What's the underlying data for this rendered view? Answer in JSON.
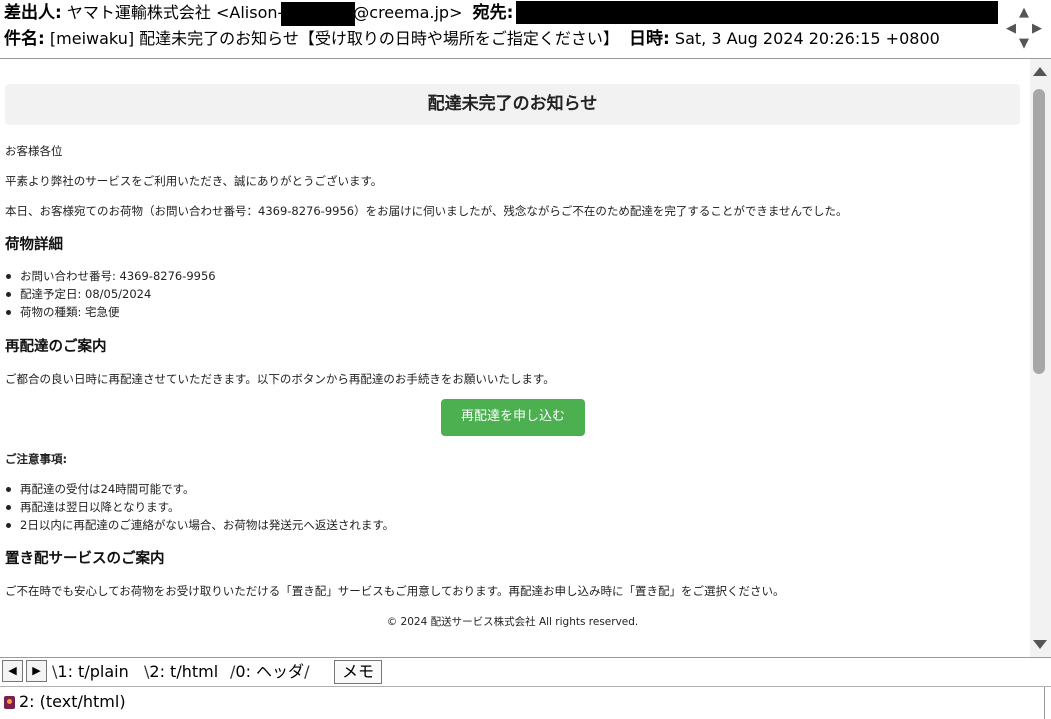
{
  "header": {
    "from_label": "差出人:",
    "from_value_prefix": "ヤマト運輸株式会社 <Alison-",
    "from_value_suffix": "@creema.jp>",
    "to_label": "宛先:",
    "subject_label": "件名:",
    "subject_value": "[meiwaku] 配達未完了のお知らせ【受け取りの日時や場所をご指定ください】",
    "date_label": "日時:",
    "date_value": "Sat, 3 Aug 2024 20:26:15 +0800"
  },
  "message": {
    "title": "配達未完了のお知らせ",
    "greeting": "お客様各位",
    "thanks": "平素より弊社のサービスをご利用いただき、誠にありがとうございます。",
    "notice": "本日、お客様宛てのお荷物（お問い合わせ番号：4369-8276-9956）をお届けに伺いましたが、残念ながらご不在のため配達を完了することができませんでした。",
    "details_heading": "荷物詳細",
    "details": [
      "お問い合わせ番号: 4369-8276-9956",
      "配達予定日: 08/05/2024",
      "荷物の種類: 宅急便"
    ],
    "redelivery_heading": "再配達のご案内",
    "redelivery_text": "ご都合の良い日時に再配達させていただきます。以下のボタンから再配達のお手続きをお願いいたします。",
    "redelivery_button": "再配達を申し込む",
    "button_color": "#4caf50",
    "caution_heading": "ご注意事項:",
    "cautions": [
      "再配達の受付は24時間可能です。",
      "再配達は翌日以降となります。",
      "2日以内に再配達のご連絡がない場合、お荷物は発送元へ返送されます。"
    ],
    "okihai_heading": "置き配サービスのご案内",
    "okihai_text": "ご不在時でも安心してお荷物をお受け取りいただける「置き配」サービスもご用意しております。再配達お申し込み時に「置き配」をご選択ください。",
    "copyright": "© 2024 配送サービス株式会社 All rights reserved."
  },
  "tabs": {
    "tab1": "1: t/plain",
    "tab2": "2: t/html",
    "tab3": "0: ヘッダ",
    "memo": "メモ"
  },
  "status": {
    "text": "2: (text/html)"
  },
  "icons": {
    "nav": "four-way-arrow-icon",
    "status": "html-part-icon"
  }
}
